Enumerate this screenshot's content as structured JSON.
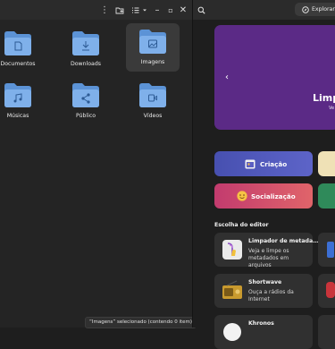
{
  "file_manager": {
    "folders": [
      {
        "label": "Documentos",
        "icon": "document-icon"
      },
      {
        "label": "Downloads",
        "icon": "download-icon"
      },
      {
        "label": "Imagens",
        "icon": "image-icon"
      },
      {
        "label": "Músicas",
        "icon": "music-icon"
      },
      {
        "label": "Público",
        "icon": "share-icon"
      },
      {
        "label": "Vídeos",
        "icon": "video-icon"
      }
    ],
    "selected_folder": "Imagens",
    "status": "“Imagens” selecionado  (contendo 0 item)"
  },
  "software_center": {
    "explore_label": "Explorar",
    "banner": {
      "title": "Limp",
      "subtitle": "Ve"
    },
    "categories": [
      {
        "label": "Criação",
        "color": "#4b56b3"
      },
      {
        "label": "Socialização",
        "color": "#c2416a"
      }
    ],
    "editor_heading": "Escolha do editor",
    "apps": [
      {
        "title": "Limpador de metada…",
        "description": "Veja e limpe os metadados em arquivos"
      },
      {
        "title": "Shortwave",
        "description": "Ouça a rádios da Internet"
      },
      {
        "title": "Khronos",
        "description": ""
      }
    ]
  },
  "colors": {
    "folder_blue": "#6fa6e3",
    "banner_purple": "#5b2a86",
    "accent_green": "#2f8a5a"
  }
}
